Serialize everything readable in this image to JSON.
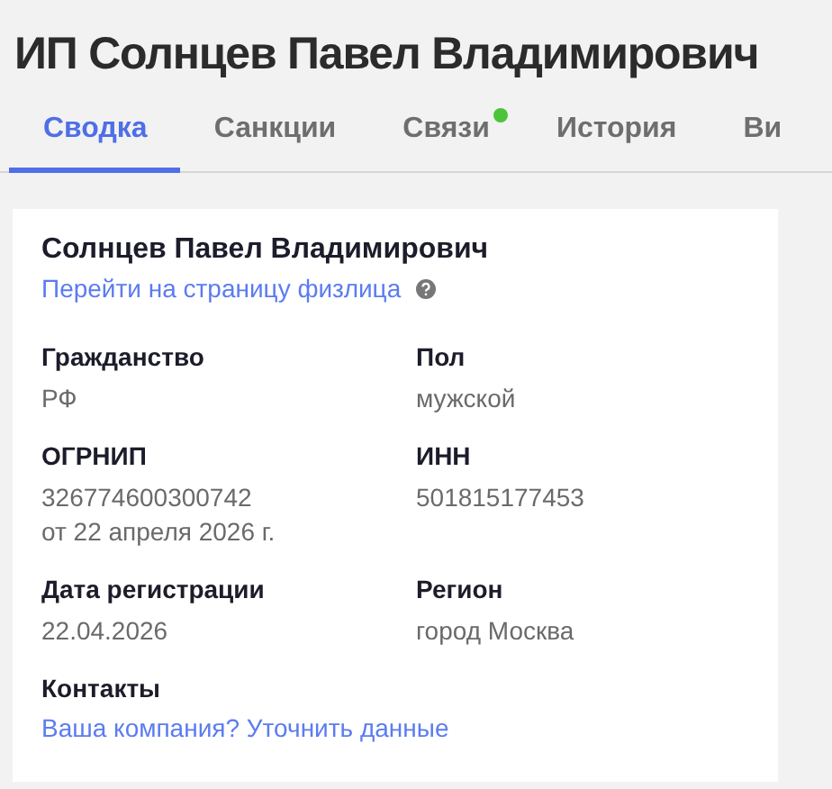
{
  "title": "ИП Солнцев Павел Владимирович",
  "tabs": [
    {
      "label": "Сводка",
      "selected": true,
      "dot": false
    },
    {
      "label": "Санкции",
      "selected": false,
      "dot": false
    },
    {
      "label": "Связи",
      "selected": false,
      "dot": true
    },
    {
      "label": "История",
      "selected": false,
      "dot": false
    },
    {
      "label": "Ви",
      "selected": false,
      "dot": false
    }
  ],
  "card": {
    "name": "Солнцев Павел Владимирович",
    "link": "Перейти на страницу физлица",
    "fields": [
      {
        "label": "Гражданство",
        "values": [
          "РФ"
        ]
      },
      {
        "label": "Пол",
        "values": [
          "мужской"
        ]
      },
      {
        "label": "ОГРНИП",
        "values": [
          "326774600300742",
          "от 22 апреля 2026 г."
        ]
      },
      {
        "label": "ИНН",
        "values": [
          "501815177453"
        ]
      },
      {
        "label": "Дата регистрации",
        "values": [
          "22.04.2026"
        ]
      },
      {
        "label": "Регион",
        "values": [
          "город Москва"
        ]
      }
    ],
    "contacts": {
      "label": "Контакты",
      "link": "Ваша компания? Уточнить данные"
    }
  }
}
